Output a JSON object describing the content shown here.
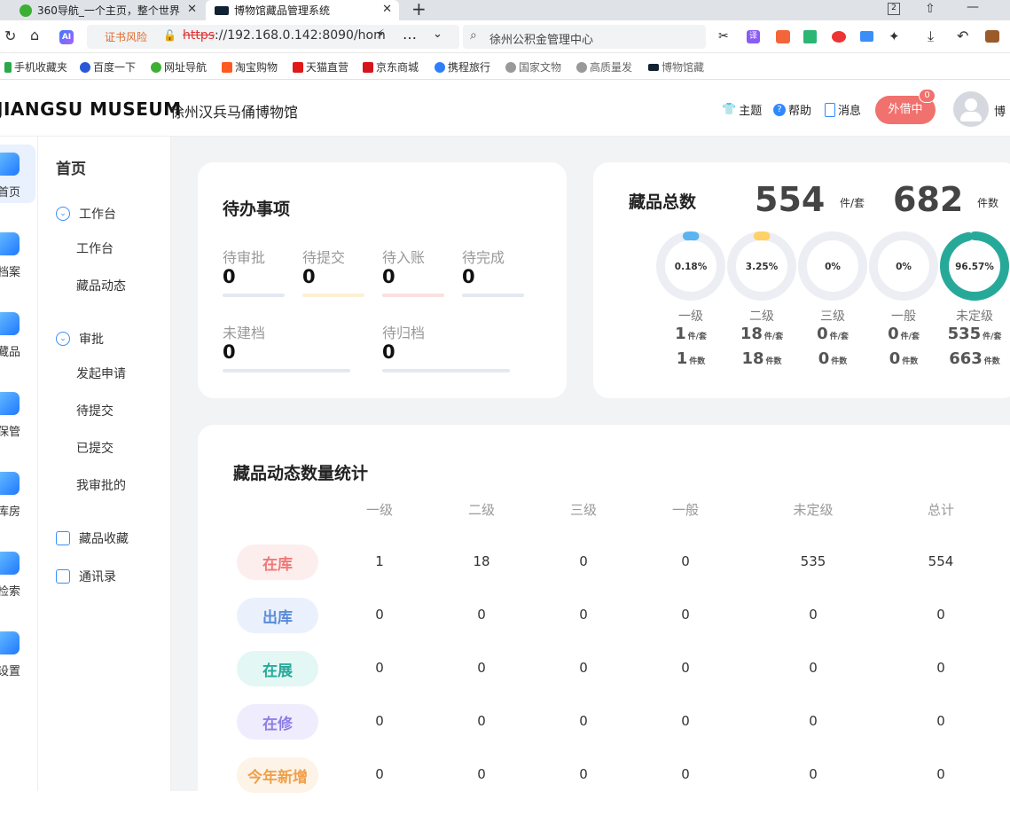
{
  "browser": {
    "tabs": [
      {
        "title": "360导航_一个主页，整个世界"
      },
      {
        "title": "博物馆藏品管理系统"
      }
    ],
    "cert_warning": "证书风险",
    "url_scheme": "https",
    "url_rest": "://192.168.0.142:8090/hom",
    "search_text": "徐州公积金管理中心",
    "bookmarks": [
      "手机收藏夹",
      "百度一下",
      "网址导航",
      "淘宝购物",
      "天猫直营",
      "京东商城",
      "携程旅行",
      "国家文物",
      "高质量发",
      "博物馆藏"
    ]
  },
  "header": {
    "logo_left": "JIANGSU",
    "logo_right": "MUSEUM",
    "museum_name": "徐州汉兵马俑博物馆",
    "theme": "主题",
    "help": "帮助",
    "message": "消息",
    "loan_button": "外借中",
    "loan_badge": "0",
    "user_name": "博"
  },
  "leftnav": [
    "首页",
    "档案",
    "藏品",
    "保管",
    "库房",
    "检索",
    "设置"
  ],
  "subnav": {
    "title": "首页",
    "groups": [
      {
        "label": "工作台",
        "items": [
          "工作台",
          "藏品动态"
        ]
      },
      {
        "label": "审批",
        "items": [
          "发起申请",
          "待提交",
          "已提交",
          "我审批的"
        ]
      }
    ],
    "extra": [
      "藏品收藏",
      "通讯录"
    ]
  },
  "todo": {
    "title": "待办事项",
    "items": [
      {
        "label": "待审批",
        "value": "0",
        "color": "#e3e8f2"
      },
      {
        "label": "待提交",
        "value": "0",
        "color": "#fdf0d4"
      },
      {
        "label": "待入账",
        "value": "0",
        "color": "#fbe0e0"
      },
      {
        "label": "待完成",
        "value": "0",
        "color": "#e3e8f2"
      },
      {
        "label": "未建档",
        "value": "0",
        "color": "#e3e8f2"
      },
      {
        "label": "待归档",
        "value": "0",
        "color": "#e3e8f2"
      }
    ]
  },
  "collection": {
    "title": "藏品总数",
    "total_sets": "554",
    "total_sets_unit": "件/套",
    "total_items": "682",
    "total_items_unit": "件数",
    "levels": [
      {
        "name": "一级",
        "pct": "0.18%",
        "frac": 0.0018,
        "color": "#5bb4f0",
        "sets": "1",
        "items": "1"
      },
      {
        "name": "二级",
        "pct": "3.25%",
        "frac": 0.0325,
        "color": "#ffd166",
        "sets": "18",
        "items": "18"
      },
      {
        "name": "三级",
        "pct": "0%",
        "frac": 0,
        "color": "#aab",
        "sets": "0",
        "items": "0"
      },
      {
        "name": "一般",
        "pct": "0%",
        "frac": 0,
        "color": "#aab",
        "sets": "0",
        "items": "0"
      },
      {
        "name": "未定级",
        "pct": "96.57%",
        "frac": 0.9657,
        "color": "#27a99a",
        "sets": "535",
        "items": "663"
      }
    ],
    "unit_sets": "件/套",
    "unit_items": "件数"
  },
  "stats": {
    "title": "藏品动态数量统计",
    "columns": [
      "一级",
      "二级",
      "三级",
      "一般",
      "未定级",
      "总计"
    ],
    "rows": [
      {
        "label": "在库",
        "color": "#f07878",
        "bg": "#fdeeee",
        "values": [
          "1",
          "18",
          "0",
          "0",
          "535",
          "554"
        ]
      },
      {
        "label": "出库",
        "color": "#5b8ad9",
        "bg": "#eaf1fc",
        "values": [
          "0",
          "0",
          "0",
          "0",
          "0",
          "0"
        ]
      },
      {
        "label": "在展",
        "color": "#27a99a",
        "bg": "#e3f7f4",
        "values": [
          "0",
          "0",
          "0",
          "0",
          "0",
          "0"
        ]
      },
      {
        "label": "在修",
        "color": "#8c7ee6",
        "bg": "#efedfd",
        "values": [
          "0",
          "0",
          "0",
          "0",
          "0",
          "0"
        ]
      },
      {
        "label": "今年新增",
        "color": "#f0a04b",
        "bg": "#fdf3e6",
        "values": [
          "0",
          "0",
          "0",
          "0",
          "0",
          "0"
        ]
      }
    ]
  }
}
